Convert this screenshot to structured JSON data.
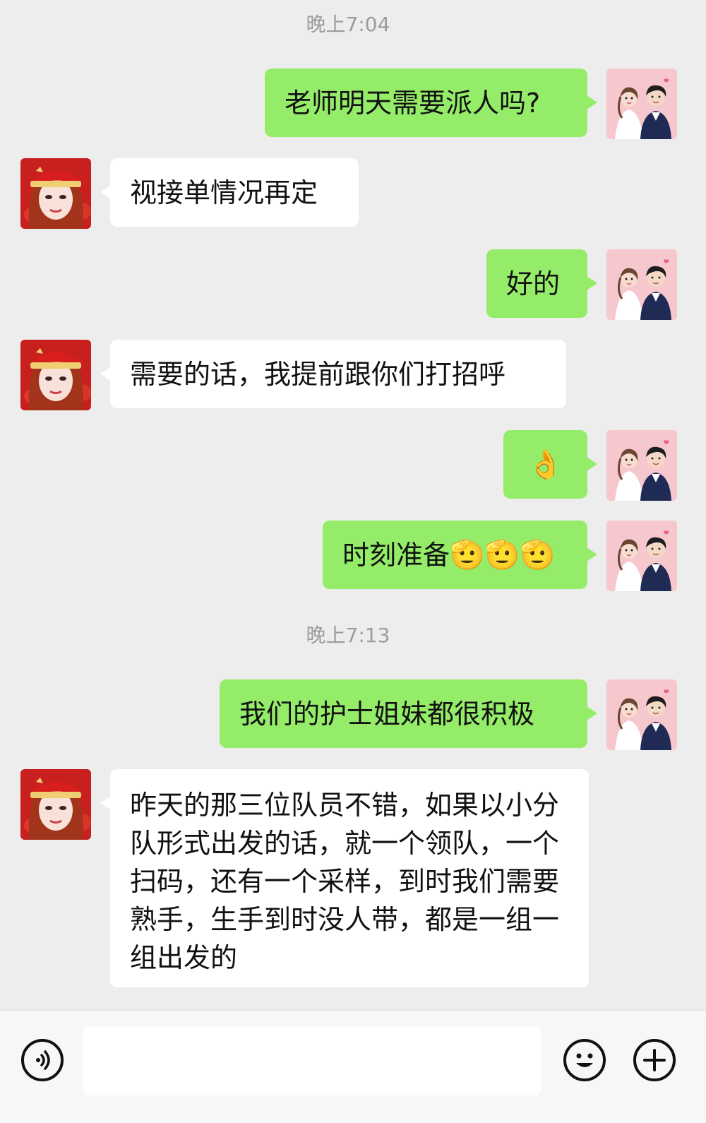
{
  "timestamps": [
    "晚上7:04",
    "晚上7:13"
  ],
  "messages": [
    {
      "side": "sent",
      "text": "老师明天需要派人吗?"
    },
    {
      "side": "received",
      "text": "视接单情况再定"
    },
    {
      "side": "sent",
      "text": "好的"
    },
    {
      "side": "received",
      "text": "需要的话，我提前跟你们打招呼"
    },
    {
      "side": "sent",
      "text": "👌"
    },
    {
      "side": "sent",
      "text": "时刻准备",
      "emoji": "🫡🫡🫡"
    },
    {
      "side": "sent",
      "text": "我们的护士姐妹都很积极"
    },
    {
      "side": "received",
      "text": "昨天的那三位队员不错，如果以小分队形式出发的话，就一个领队，一个扫码，还有一个采样，到时我们需要熟手，生手到时没人带，都是一组一组出发的"
    }
  ],
  "input_bar": {
    "text": "",
    "icons": [
      "voice-icon",
      "emoji-face-icon",
      "plus-icon"
    ]
  },
  "colors": {
    "background": "#ededed",
    "sent_bubble": "#95ec69",
    "received_bubble": "#ffffff",
    "timestamp": "#9c9c9c"
  }
}
